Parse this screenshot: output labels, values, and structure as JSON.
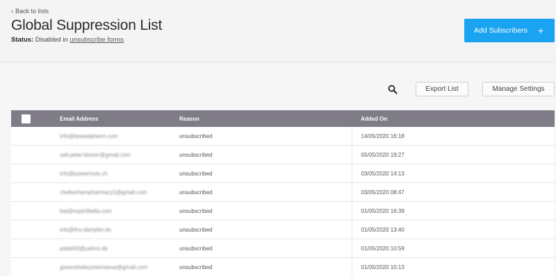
{
  "header": {
    "back_label": "Back to lists",
    "title": "Global Suppression List",
    "status_label": "Status:",
    "status_text": "Disabled in",
    "status_link": "unsubscribe forms",
    "add_button_label": "Add Subscribers",
    "add_button_icon": "+"
  },
  "toolbar": {
    "search_icon": "magnifier",
    "export_label": "Export List",
    "manage_label": "Manage Settings"
  },
  "table": {
    "columns": [
      "Email Address",
      "Reason",
      "Added On"
    ],
    "rows": [
      {
        "email": "info@lawsatpharm.com",
        "reason": "unsubscribed",
        "added": "14/05/2020 16:18"
      },
      {
        "email": "sall.peter.kleiser@gmail.com",
        "reason": "unsubscribed",
        "added": "05/05/2020 19:27"
      },
      {
        "email": "info@powernuts.ch",
        "reason": "unsubscribed",
        "added": "03/05/2020 14:13"
      },
      {
        "email": "cheltenhampharmacy1@gmail.com",
        "reason": "unsubscribed",
        "added": "03/05/2020 08:47"
      },
      {
        "email": "bat@espiritbella.com",
        "reason": "unsubscribed",
        "added": "01/05/2020 16:39"
      },
      {
        "email": "info@ihs-dampfer.de",
        "reason": "unsubscribed",
        "added": "01/05/2020 13:40"
      },
      {
        "email": "patali43@yahoo.de",
        "reason": "unsubscribed",
        "added": "01/05/2020 10:59"
      },
      {
        "email": "greenshokeyintensiesa@gmail.com",
        "reason": "unsubscribed",
        "added": "01/05/2020 10:13"
      }
    ]
  },
  "colors": {
    "accent": "#1aa3f0",
    "table_header": "#7f7c88"
  }
}
